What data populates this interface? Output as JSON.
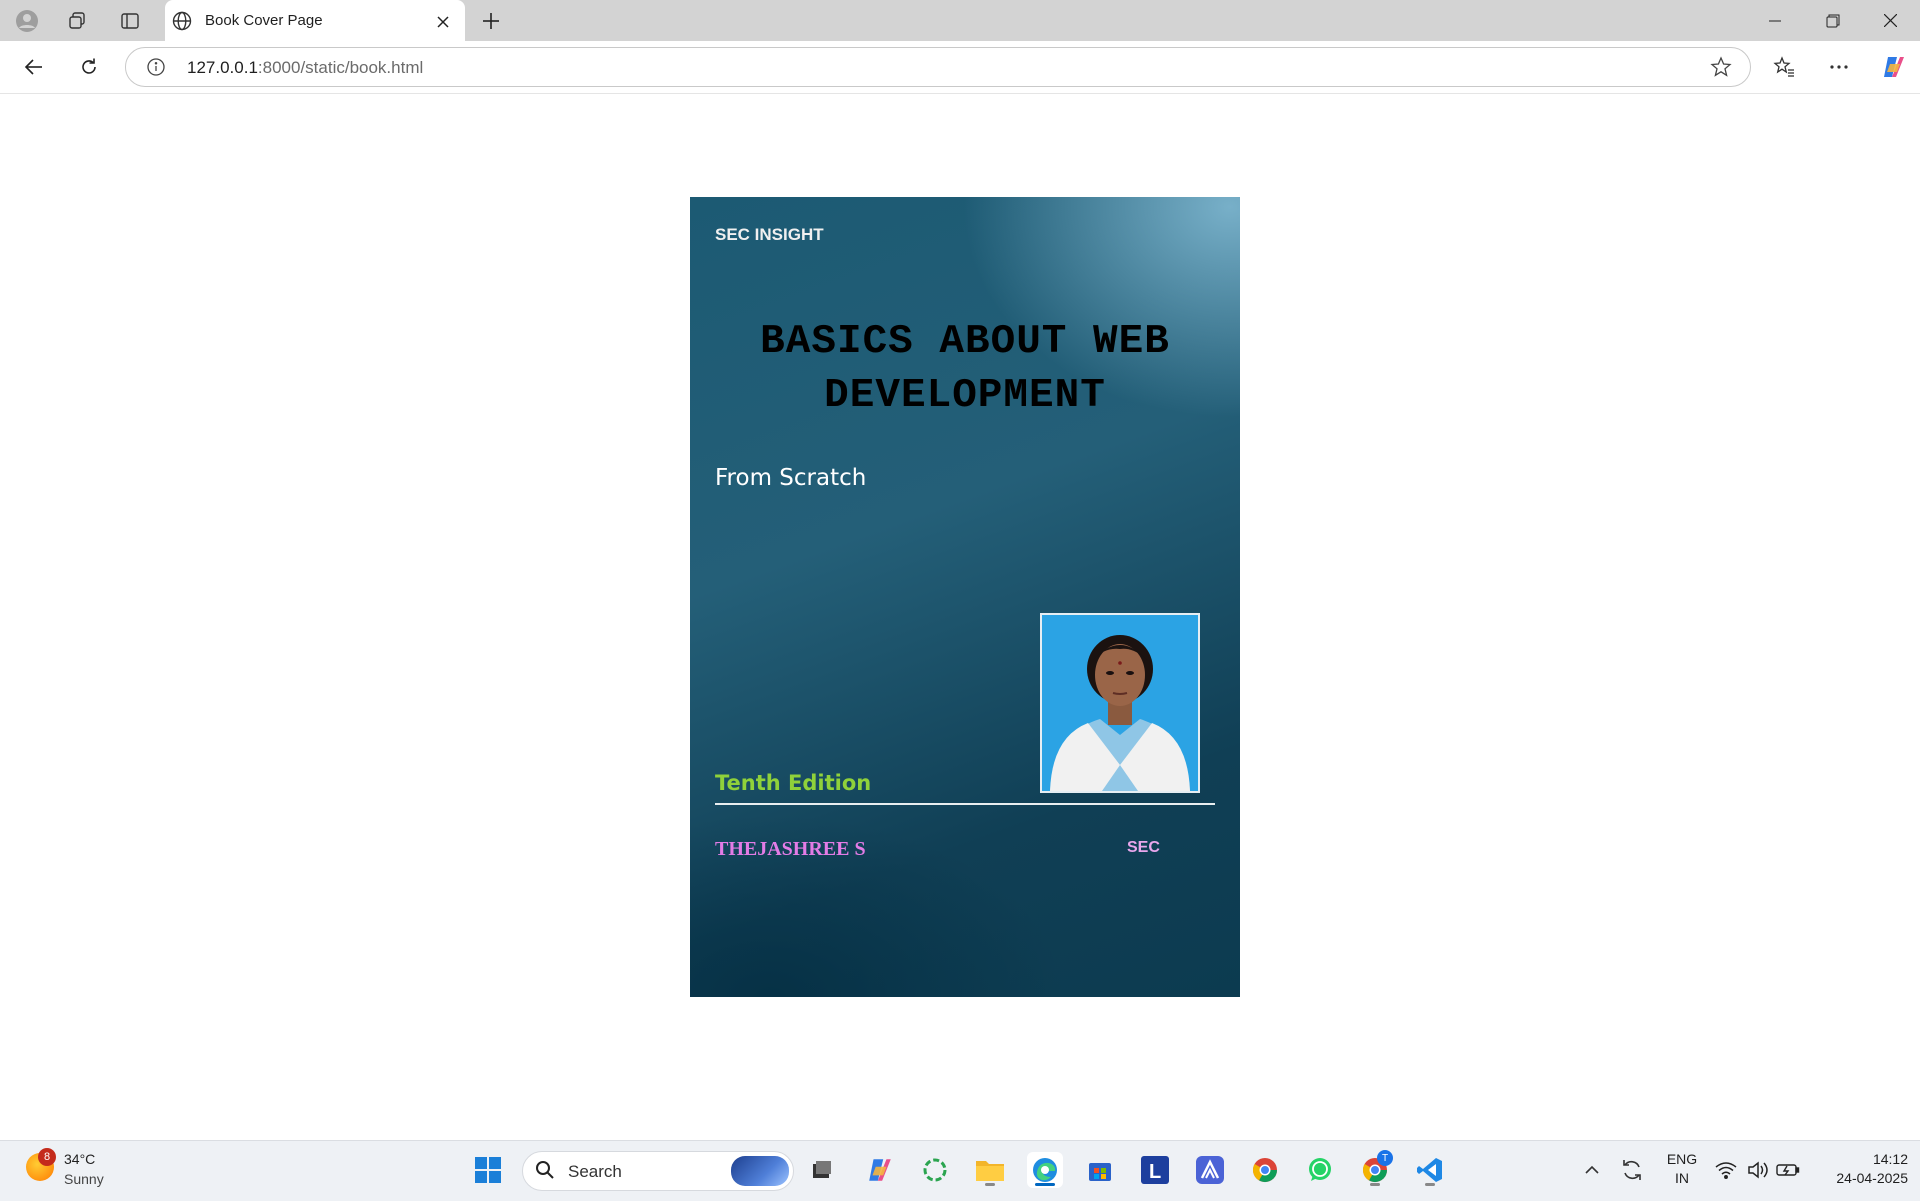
{
  "browser": {
    "tab_title": "Book Cover Page",
    "url_host": "127.0.0.1",
    "url_path": ":8000/static/book.html",
    "icons": [
      "profile-icon",
      "workspaces-icon",
      "tab-actions-icon",
      "globe-icon",
      "close-icon",
      "plus-icon",
      "back-icon",
      "refresh-icon",
      "info-icon",
      "star-icon",
      "favorites-icon",
      "more-icon",
      "copilot-icon"
    ]
  },
  "cover": {
    "publisher": "SEC INSIGHT",
    "title_line1": "BASICS ABOUT WEB",
    "title_line2": "DEVELOPMENT",
    "subtitle": "From Scratch",
    "edition": "Tenth Edition",
    "author": "THEJASHREE S",
    "organization": "SEC",
    "colors": {
      "edition": "#8fd13a",
      "author": "#e37ce6",
      "organization": "#e8a6ec",
      "photo_background": "#2ba3e4"
    }
  },
  "taskbar": {
    "weather_badge": "8",
    "weather_temp": "34°C",
    "weather_condition": "Sunny",
    "search_label": "Search",
    "tray_lang_1": "ENG",
    "tray_lang_2": "IN",
    "time": "14:12",
    "date": "24-04-2025",
    "chrome_badge": "T"
  }
}
